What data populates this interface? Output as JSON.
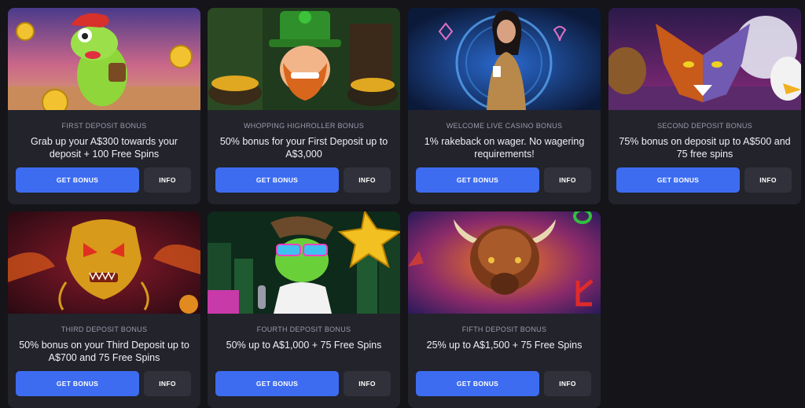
{
  "bonuses": [
    {
      "label": "FIRST DEPOSIT BONUS",
      "title": "Grab up your A$300 towards your deposit + 100 Free Spins",
      "get": "GET BONUS",
      "info": "INFO"
    },
    {
      "label": "WHOPPING HIGHROLLER BONUS",
      "title": "50% bonus for your First Deposit up to A$3,000",
      "get": "GET BONUS",
      "info": "INFO"
    },
    {
      "label": "WELCOME LIVE CASINO BONUS",
      "title": "1% rakeback on wager. No wagering requirements!",
      "get": "GET BONUS",
      "info": "INFO"
    },
    {
      "label": "SECOND DEPOSIT BONUS",
      "title": "75% bonus on deposit up to A$500 and 75 free spins",
      "get": "GET BONUS",
      "info": "INFO"
    },
    {
      "label": "THIRD DEPOSIT BONUS",
      "title": "50% bonus on your Third Deposit up to A$700 and 75 Free Spins",
      "get": "GET BONUS",
      "info": "INFO"
    },
    {
      "label": "FOURTH DEPOSIT BONUS",
      "title": "50% up to A$1,000 + 75 Free Spins",
      "get": "GET BONUS",
      "info": "INFO"
    },
    {
      "label": "FIFTH DEPOSIT BONUS",
      "title": "25% up to A$1,500 + 75 Free Spins",
      "get": "GET BONUS",
      "info": "INFO"
    }
  ],
  "colors": {
    "accent": "#3d6cf0",
    "card": "#22232b",
    "page": "#141419",
    "secondary_button": "#30313a"
  }
}
